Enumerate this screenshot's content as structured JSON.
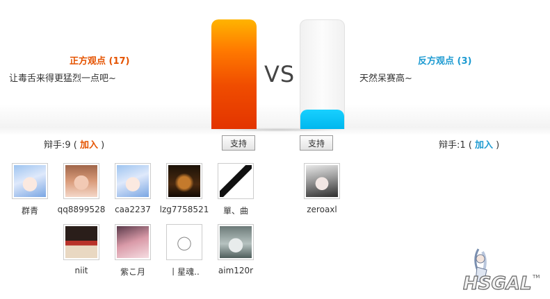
{
  "pro": {
    "title": "正方观点 (17)",
    "text": "让毒舌来得更猛烈一点吧~",
    "debaters_prefix": "辩手:9 (",
    "join_label": "加入",
    "debaters_suffix": ")",
    "support_label": "支持",
    "vote_share": 1.0,
    "users": [
      {
        "name": "群青",
        "avatar": "anime-girl-blue-hair-avatar"
      },
      {
        "name": "qq8899528",
        "avatar": "girl-photo-avatar"
      },
      {
        "name": "caa2237",
        "avatar": "anime-girl-blue-hair-avatar"
      },
      {
        "name": "lzg7758521",
        "avatar": "dark-anime-avatar"
      },
      {
        "name": "單、曲",
        "avatar": "sword-sketch-avatar"
      },
      {
        "name": "niit",
        "avatar": "cartoon-sign-avatar"
      },
      {
        "name": "紫こ月",
        "avatar": "pink-art-avatar"
      },
      {
        "name": "丨星魂..",
        "avatar": "manga-sketch-avatar"
      },
      {
        "name": "aim120r",
        "avatar": "anime-gray-hair-avatar"
      }
    ]
  },
  "con": {
    "title": "反方观点 (3)",
    "text": "天然呆赛高~",
    "debaters_prefix": "辩手:1 (",
    "join_label": "加入",
    "debaters_suffix": ")",
    "support_label": "支持",
    "vote_share": 0.176,
    "users": [
      {
        "name": "zeroaxl",
        "avatar": "anime-silver-hair-avatar"
      }
    ]
  },
  "vs_label": "VS",
  "logo_text": "HSGAL",
  "logo_tm": "TM",
  "colors": {
    "pro_accent": "#e55300",
    "con_accent": "#1e9bd2",
    "pro_bar": "#f04d00",
    "con_bar": "#00b7ee"
  }
}
